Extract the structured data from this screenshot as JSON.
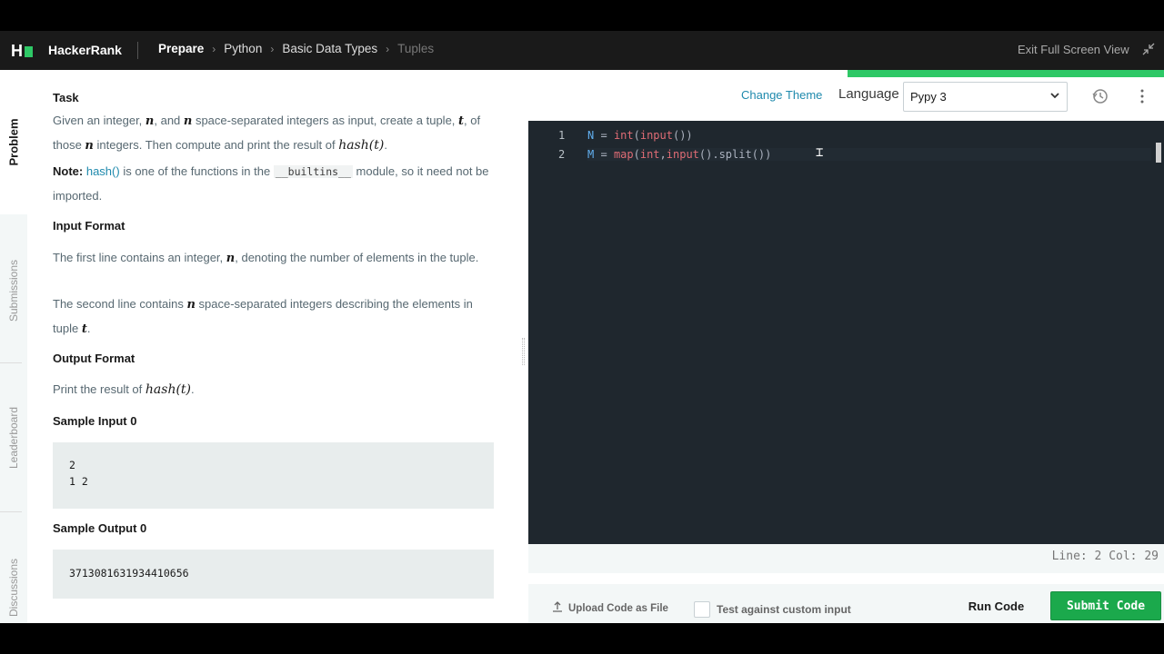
{
  "header": {
    "logo_letter": "H",
    "brand": "HackerRank",
    "breadcrumbs": [
      "Prepare",
      "Python",
      "Basic Data Types",
      "Tuples"
    ],
    "exit_label": "Exit Full Screen View"
  },
  "rail": {
    "tabs": [
      "Problem",
      "Submissions",
      "Leaderboard",
      "Discussions"
    ]
  },
  "problem": {
    "task_heading": "Task",
    "task_text_1": "Given an integer, ",
    "task_var_n1": "n",
    "task_text_2": ", and ",
    "task_var_n2": "n",
    "task_text_3": " space-separated integers as input, create a tuple, ",
    "task_var_t": "t",
    "task_text_4": ", of those ",
    "task_var_n3": "n",
    "task_text_5": " integers. Then compute and print the result of ",
    "task_hash": "hash(t)",
    "task_text_6": ".",
    "note_label": "Note:",
    "note_link": "hash()",
    "note_text_1": " is one of the functions in the ",
    "note_code": "__builtins__",
    "note_text_2": " module, so it need not be imported.",
    "input_heading": "Input Format",
    "input_line1_a": "The first line contains an integer, ",
    "input_line1_var": "n",
    "input_line1_b": ", denoting the number of elements in the tuple.",
    "input_line2_a": "The second line contains ",
    "input_line2_var": "n",
    "input_line2_b": " space-separated integers describing the elements in tuple ",
    "input_line2_var2": "t",
    "input_line2_c": ".",
    "output_heading": "Output Format",
    "output_text_a": "Print the result of ",
    "output_hash": "hash(t)",
    "output_text_b": ".",
    "sample_input_heading": "Sample Input 0",
    "sample_input_lines": [
      "2",
      "1 2"
    ],
    "sample_output_heading": "Sample Output 0",
    "sample_output": "3713081631934410656"
  },
  "editor": {
    "change_theme": "Change Theme",
    "language_label": "Language",
    "language_value": "Pypy 3",
    "line_numbers": [
      "1",
      "2"
    ],
    "status": "Line: 2 Col: 29"
  },
  "bottom": {
    "upload_label": "Upload Code as File",
    "custom_input_label": "Test against custom input",
    "run_label": "Run Code",
    "submit_label": "Submit Code"
  },
  "colors": {
    "accent_green": "#1ba94c",
    "link_blue": "#1f8aad",
    "editor_bg": "#1f272e"
  }
}
